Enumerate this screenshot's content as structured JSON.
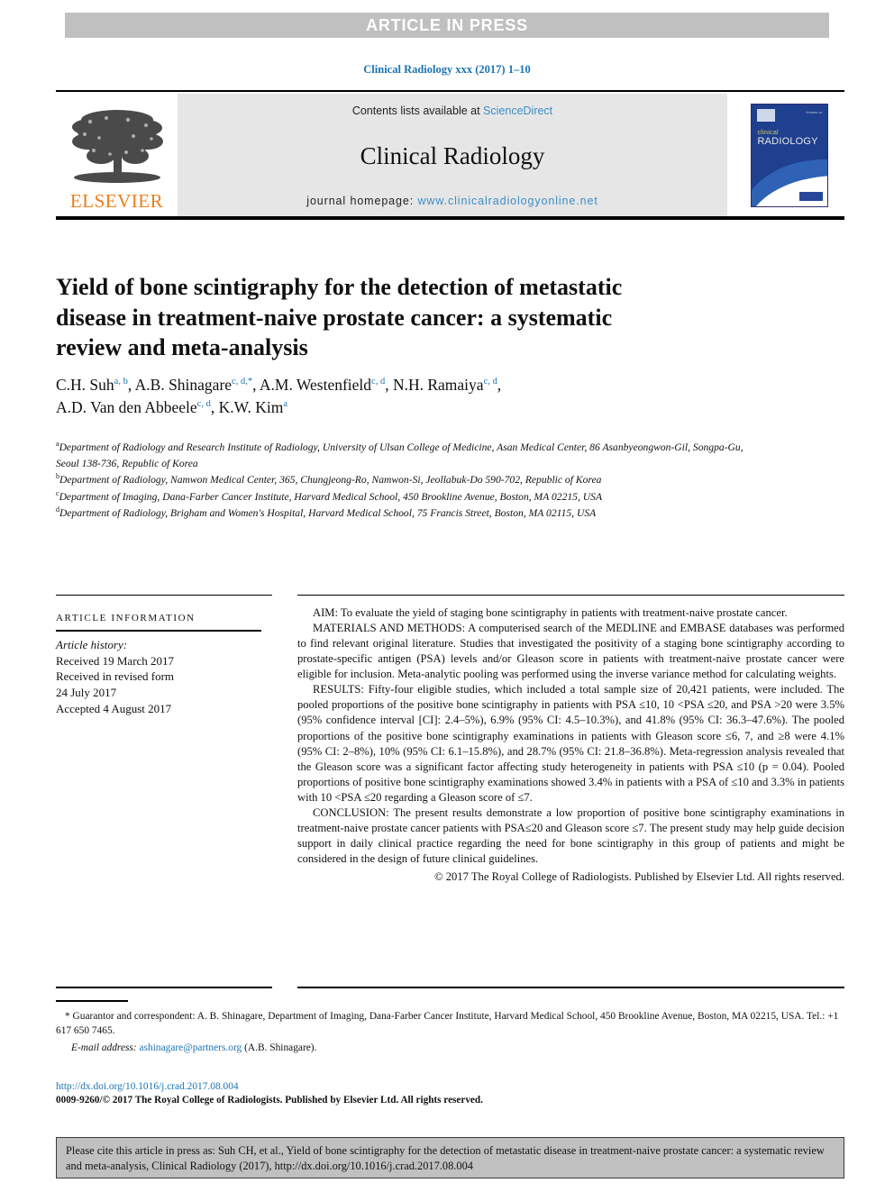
{
  "banner": {
    "text": "ARTICLE IN PRESS"
  },
  "running_head": "Clinical Radiology xxx (2017) 1–10",
  "masthead": {
    "contents_prefix": "Contents lists available at ",
    "contents_link": "ScienceDirect",
    "journal_title": "Clinical Radiology",
    "homepage_prefix": "journal homepage: ",
    "homepage_link": "www.clinicalradiologyonline.net",
    "publisher_name": "ELSEVIER",
    "cover": {
      "line1": "clinical",
      "line2": "RADIOLOGY",
      "corner_text": "Volume xx"
    }
  },
  "title": "Yield of bone scintigraphy for the detection of metastatic disease in treatment-naive prostate cancer: a systematic review and meta-analysis",
  "authors_line1_parts": {
    "a1_name": "C.H. Suh",
    "a1_sup": "a, b",
    "a2_name": ", A.B. Shinagare",
    "a2_sup": "c, d,",
    "a2_star": "*",
    "a3_name": ", A.M. Westenfield",
    "a3_sup": "c, d",
    "a4_name": ", N.H. Ramaiya",
    "a4_sup": "c, d"
  },
  "authors_line2_parts": {
    "a5_name": "A.D. Van den Abbeele",
    "a5_sup": "c, d",
    "a6_name": ", K.W. Kim",
    "a6_sup": "a"
  },
  "affiliations": [
    {
      "marker": "a",
      "text": "Department of Radiology and Research Institute of Radiology, University of Ulsan College of Medicine, Asan Medical Center, 86 Asanbyeongwon-Gil, Songpa-Gu, Seoul 138-736, Republic of Korea"
    },
    {
      "marker": "b",
      "text": "Department of Radiology, Namwon Medical Center, 365, Chungjeong-Ro, Namwon-Si, Jeollabuk-Do 590-702, Republic of Korea"
    },
    {
      "marker": "c",
      "text": "Department of Imaging, Dana-Farber Cancer Institute, Harvard Medical School, 450 Brookline Avenue, Boston, MA 02215, USA"
    },
    {
      "marker": "d",
      "text": "Department of Radiology, Brigham and Women's Hospital, Harvard Medical School, 75 Francis Street, Boston, MA 02115, USA"
    }
  ],
  "article_information": {
    "heading": "ARTICLE INFORMATION",
    "history_label": "Article history:",
    "history_lines": [
      "Received 19 March 2017",
      "Received in revised form",
      "24 July 2017",
      "Accepted 4 August 2017"
    ]
  },
  "abstract": {
    "aim": "AIM: To evaluate the yield of staging bone scintigraphy in patients with treatment-naive prostate cancer.",
    "materials_and_methods": "MATERIALS AND METHODS: A computerised search of the MEDLINE and EMBASE databases was performed to find relevant original literature. Studies that investigated the positivity of a staging bone scintigraphy according to prostate-specific antigen (PSA) levels and/or Gleason score in patients with treatment-naive prostate cancer were eligible for inclusion. Meta-analytic pooling was performed using the inverse variance method for calculating weights.",
    "results": "RESULTS: Fifty-four eligible studies, which included a total sample size of 20,421 patients, were included. The pooled proportions of the positive bone scintigraphy in patients with PSA ≤10, 10 <PSA ≤20, and PSA >20 were 3.5% (95% confidence interval [CI]: 2.4–5%), 6.9% (95% CI: 4.5–10.3%), and 41.8% (95% CI: 36.3–47.6%). The pooled proportions of the positive bone scintigraphy examinations in patients with Gleason score ≤6, 7, and ≥8 were 4.1% (95% CI: 2–8%), 10% (95% CI: 6.1–15.8%), and 28.7% (95% CI: 21.8–36.8%). Meta-regression analysis revealed that the Gleason score was a significant factor affecting study heterogeneity in patients with PSA ≤10 (p = 0.04). Pooled proportions of positive bone scintigraphy examinations showed 3.4% in patients with a PSA of ≤10 and 3.3% in patients with 10 <PSA ≤20 regarding a Gleason score of ≤7.",
    "conclusion": "CONCLUSION: The present results demonstrate a low proportion of positive bone scintigraphy examinations in treatment-naive prostate cancer patients with PSA≤20 and Gleason score ≤7. The present study may help guide decision support in daily clinical practice regarding the need for bone scintigraphy in this group of patients and might be considered in the design of future clinical guidelines.",
    "copyright": "© 2017 The Royal College of Radiologists. Published by Elsevier Ltd. All rights reserved."
  },
  "footnotes": {
    "correspondence": "* Guarantor and correspondent: A. B. Shinagare, Department of Imaging, Dana-Farber Cancer Institute, Harvard Medical School, 450 Brookline Avenue, Boston, MA 02215, USA. Tel.: +1 617 650 7465.",
    "email_label": "E-mail address:",
    "email_link": "ashinagare@partners.org",
    "email_suffix": "(A.B. Shinagare)."
  },
  "doi_block": {
    "doi_url": "http://dx.doi.org/10.1016/j.crad.2017.08.004",
    "issn_line": "0009-9260/© 2017 The Royal College of Radiologists. Published by Elsevier Ltd. All rights reserved."
  },
  "cite_box": {
    "text": "Please cite this article in press as: Suh CH, et al., Yield of bone scintigraphy for the detection of metastatic disease in treatment-naive prostate cancer: a systematic review and meta-analysis, Clinical Radiology (2017), http://dx.doi.org/10.1016/j.crad.2017.08.004"
  },
  "colors": {
    "banner_bg": "#c0c0c0",
    "link_blue": "#1a74b3",
    "masthead_bg": "#e6e6e6",
    "elsevier_orange": "#ef7d1a",
    "cite_box_bg": "#c0c0c0"
  }
}
